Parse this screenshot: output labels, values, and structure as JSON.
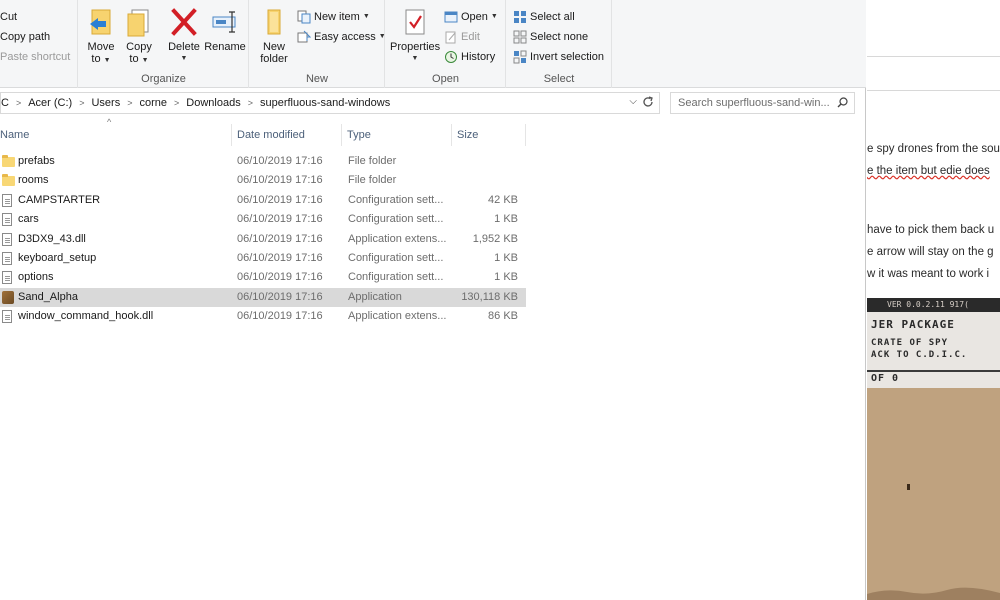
{
  "ribbon": {
    "clipboard": {
      "cut": "Cut",
      "copy_path": "Copy path",
      "paste_shortcut": "Paste shortcut"
    },
    "organize": {
      "move_to": [
        "Move",
        "to"
      ],
      "copy_to": [
        "Copy",
        "to"
      ],
      "delete": "Delete",
      "rename": "Rename",
      "label": "Organize"
    },
    "new": {
      "new_folder": [
        "New",
        "folder"
      ],
      "new_item": "New item",
      "easy_access": "Easy access",
      "label": "New"
    },
    "open": {
      "properties": "Properties",
      "open": "Open",
      "edit": "Edit",
      "history": "History",
      "label": "Open"
    },
    "select": {
      "select_all": "Select all",
      "select_none": "Select none",
      "invert_selection": "Invert selection",
      "label": "Select"
    }
  },
  "address": {
    "crumbs": [
      "C",
      "Acer (C:)",
      "Users",
      "corne",
      "Downloads",
      "superfluous-sand-windows"
    ]
  },
  "search": {
    "placeholder": "Search superfluous-sand-win..."
  },
  "columns": {
    "name": "Name",
    "date": "Date modified",
    "type": "Type",
    "size": "Size"
  },
  "files": [
    {
      "name": "prefabs",
      "date": "06/10/2019 17:16",
      "type": "File folder",
      "size": "",
      "icon": "folder-icon"
    },
    {
      "name": "rooms",
      "date": "06/10/2019 17:16",
      "type": "File folder",
      "size": "",
      "icon": "folder-icon"
    },
    {
      "name": "CAMPSTARTER",
      "date": "06/10/2019 17:16",
      "type": "Configuration sett...",
      "size": "42 KB",
      "icon": "config-file-icon"
    },
    {
      "name": "cars",
      "date": "06/10/2019 17:16",
      "type": "Configuration sett...",
      "size": "1 KB",
      "icon": "config-file-icon"
    },
    {
      "name": "D3DX9_43.dll",
      "date": "06/10/2019 17:16",
      "type": "Application extens...",
      "size": "1,952 KB",
      "icon": "dll-file-icon"
    },
    {
      "name": "keyboard_setup",
      "date": "06/10/2019 17:16",
      "type": "Configuration sett...",
      "size": "1 KB",
      "icon": "config-file-icon"
    },
    {
      "name": "options",
      "date": "06/10/2019 17:16",
      "type": "Configuration sett...",
      "size": "1 KB",
      "icon": "config-file-icon"
    },
    {
      "name": "Sand_Alpha",
      "date": "06/10/2019 17:16",
      "type": "Application",
      "size": "130,118 KB",
      "icon": "app-icon",
      "selected": true
    },
    {
      "name": "window_command_hook.dll",
      "date": "06/10/2019 17:16",
      "type": "Application extens...",
      "size": "86 KB",
      "icon": "dll-file-icon"
    }
  ],
  "browser": {
    "lines": [
      "e spy drones from the sou",
      "e the item but edie does",
      "have to pick them back u",
      "e arrow will stay on the g",
      "w it was meant to work i"
    ],
    "game": {
      "version": "VER 0.0.2.11  917(",
      "line1": "JER PACKAGE",
      "line2": "CRATE OF SPY",
      "line3": "ACK TO C.D.I.C.",
      "count": "OF 0"
    }
  }
}
